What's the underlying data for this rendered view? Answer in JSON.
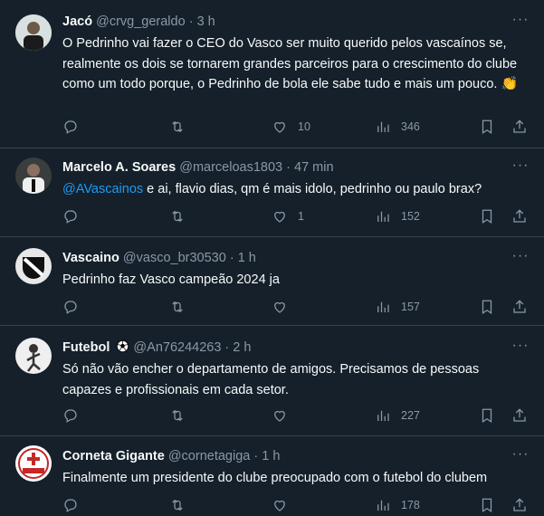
{
  "tweets": [
    {
      "name": "Jacó",
      "handle": "@crvg_geraldo",
      "time": "3 h",
      "text": "O Pedrinho vai fazer o CEO do Vasco ser muito querido pelos vascaínos se, realmente os dois se tornarem grandes parceiros para o crescimento do clube como um todo porque, o Pedrinho de bola ele sabe tudo e mais um pouco.",
      "emoji": "👏",
      "replies": "",
      "retweets": "",
      "likes": "10",
      "views": "346"
    },
    {
      "name": "Marcelo A. Soares",
      "handle": "@marceloas1803",
      "time": "47 min",
      "mention": "@AVascainos",
      "text": " e ai, flavio dias, qm é mais idolo, pedrinho ou paulo brax?",
      "replies": "",
      "retweets": "",
      "likes": "1",
      "views": "152"
    },
    {
      "name": "Vascaino",
      "handle": "@vasco_br30530",
      "time": "1 h",
      "text": "Pedrinho faz Vasco campeão 2024 ja",
      "replies": "",
      "retweets": "",
      "likes": "",
      "views": "157"
    },
    {
      "name": "Futebol",
      "handle": "@An76244263",
      "time": "2 h",
      "text": "Só não vão encher o departamento de amigos. Precisamos de pessoas capazes e profissionais em cada setor.",
      "replies": "",
      "retweets": "",
      "likes": "",
      "views": "227"
    },
    {
      "name": "Corneta Gigante",
      "handle": "@cornetagiga",
      "time": "1 h",
      "text": "Finalmente um presidente do clube preocupado com o futebol do clubem",
      "replies": "",
      "retweets": "",
      "likes": "",
      "views": "178"
    }
  ],
  "separator": "·",
  "more_label": "···",
  "colors": {
    "background": "#15202b",
    "text": "#f7f9f9",
    "muted": "#8b98a5",
    "accent": "#1d9bf0",
    "border": "#38444d"
  },
  "icons": [
    "reply-icon",
    "retweet-icon",
    "like-icon",
    "views-icon",
    "bookmark-icon",
    "share-icon",
    "more-icon"
  ]
}
